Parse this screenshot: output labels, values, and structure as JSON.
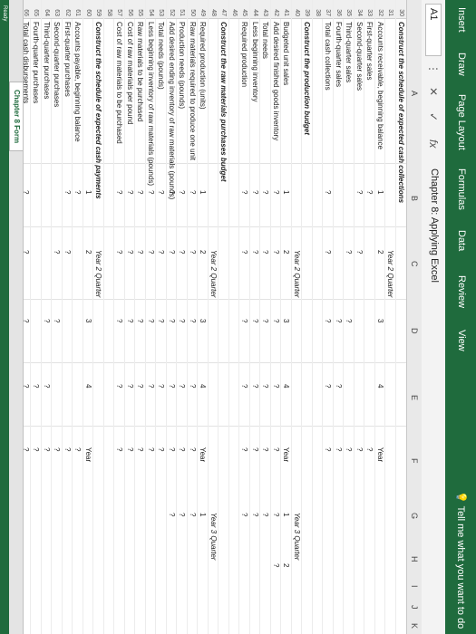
{
  "ribbon": {
    "tabs": [
      "Insert",
      "Draw",
      "Page Layout",
      "Formulas",
      "Data",
      "Review",
      "View"
    ],
    "tell_me": "Tell me what you want to do"
  },
  "formula_bar": {
    "name_box": "A1",
    "content": "Chapter 8: Applying Excel"
  },
  "columns": [
    "A",
    "B",
    "C",
    "D",
    "E",
    "F",
    "G",
    "H",
    "I",
    "J",
    "K"
  ],
  "rows": [
    {
      "n": "30",
      "label": "Construct the schedule of expected cash collections",
      "bold": true,
      "cells": []
    },
    {
      "n": "31",
      "label": "",
      "cells": [
        {
          "c": "c",
          "t": "Year 2 Quarter",
          "i": true
        }
      ]
    },
    {
      "n": "32",
      "label": "Accounts receivable, beginning balance",
      "cells": [
        {
          "c": "b",
          "t": "1"
        },
        {
          "c": "c",
          "t": "2"
        },
        {
          "c": "d",
          "t": "3"
        },
        {
          "c": "e",
          "t": "4"
        },
        {
          "c": "f",
          "t": "Year"
        }
      ]
    },
    {
      "n": "33",
      "label": "First-quarter sales",
      "cells": [
        {
          "c": "b",
          "t": "?"
        },
        {
          "c": "f",
          "t": "?"
        }
      ]
    },
    {
      "n": "34",
      "label": "Second-quarter sales",
      "cells": [
        {
          "c": "b",
          "t": "?"
        },
        {
          "c": "c",
          "t": "?"
        },
        {
          "c": "f",
          "t": "?"
        }
      ]
    },
    {
      "n": "35",
      "label": "Third-quarter sales",
      "cells": [
        {
          "c": "c",
          "t": "?"
        },
        {
          "c": "d",
          "t": "?"
        },
        {
          "c": "f",
          "t": "?"
        }
      ]
    },
    {
      "n": "36",
      "label": "Fourth-quarter sales",
      "cells": [
        {
          "c": "d",
          "t": "?"
        },
        {
          "c": "e",
          "t": "?"
        },
        {
          "c": "f",
          "t": "?"
        }
      ]
    },
    {
      "n": "37",
      "label": "Total cash collections",
      "cells": [
        {
          "c": "b",
          "t": "?"
        },
        {
          "c": "c",
          "t": "?"
        },
        {
          "c": "d",
          "t": "?"
        },
        {
          "c": "e",
          "t": "?"
        },
        {
          "c": "f",
          "t": "?"
        }
      ]
    },
    {
      "n": "38",
      "label": "",
      "cells": []
    },
    {
      "n": "39",
      "label": "Construct the production budget",
      "bold": true,
      "cells": []
    },
    {
      "n": "40",
      "label": "",
      "cells": [
        {
          "c": "c",
          "t": "Year 2 Quarter",
          "i": true
        },
        {
          "c": "g",
          "t": "Year 3 Quarter",
          "i": true
        }
      ]
    },
    {
      "n": "41",
      "label": "Budgeted unit sales",
      "cells": [
        {
          "c": "b",
          "t": "1"
        },
        {
          "c": "c",
          "t": "2"
        },
        {
          "c": "d",
          "t": "3"
        },
        {
          "c": "e",
          "t": "4"
        },
        {
          "c": "f",
          "t": "Year"
        },
        {
          "c": "g",
          "t": "1"
        },
        {
          "c": "h",
          "t": "2"
        }
      ]
    },
    {
      "n": "42",
      "label": "Add desired finished goods inventory",
      "cells": [
        {
          "c": "b",
          "t": "?"
        },
        {
          "c": "c",
          "t": "?"
        },
        {
          "c": "d",
          "t": "?"
        },
        {
          "c": "e",
          "t": "?"
        },
        {
          "c": "f",
          "t": "?"
        },
        {
          "c": "g",
          "t": "?"
        },
        {
          "c": "h",
          "t": "?"
        }
      ]
    },
    {
      "n": "43",
      "label": "Total needs",
      "cells": [
        {
          "c": "b",
          "t": "?"
        },
        {
          "c": "c",
          "t": "?"
        },
        {
          "c": "d",
          "t": "?"
        },
        {
          "c": "e",
          "t": "?"
        },
        {
          "c": "f",
          "t": "?"
        },
        {
          "c": "g",
          "t": "?"
        }
      ]
    },
    {
      "n": "44",
      "label": "Less beginning inventory",
      "cells": [
        {
          "c": "b",
          "t": "?"
        },
        {
          "c": "c",
          "t": "?"
        },
        {
          "c": "d",
          "t": "?"
        },
        {
          "c": "e",
          "t": "?"
        },
        {
          "c": "f",
          "t": "?"
        },
        {
          "c": "g",
          "t": "?"
        }
      ]
    },
    {
      "n": "45",
      "label": "Required production",
      "cells": [
        {
          "c": "b",
          "t": "?"
        },
        {
          "c": "c",
          "t": "?"
        },
        {
          "c": "d",
          "t": "?"
        },
        {
          "c": "e",
          "t": "?"
        },
        {
          "c": "f",
          "t": "?"
        },
        {
          "c": "g",
          "t": "?"
        }
      ]
    },
    {
      "n": "46",
      "label": "",
      "cells": []
    },
    {
      "n": "47",
      "label": "Construct the raw materials purchases budget",
      "bold": true,
      "cells": []
    },
    {
      "n": "48",
      "label": "",
      "cells": [
        {
          "c": "c",
          "t": "Year 2 Quarter",
          "i": true
        },
        {
          "c": "g",
          "t": "Year 3 Quarter",
          "i": true
        }
      ]
    },
    {
      "n": "49",
      "label": "Required production (units)",
      "cells": [
        {
          "c": "b",
          "t": "1"
        },
        {
          "c": "c",
          "t": "2"
        },
        {
          "c": "d",
          "t": "3"
        },
        {
          "c": "e",
          "t": "4"
        },
        {
          "c": "f",
          "t": "Year"
        },
        {
          "c": "g",
          "t": "1"
        }
      ]
    },
    {
      "n": "50",
      "label": "Raw materials required to produce one unit",
      "cells": [
        {
          "c": "b",
          "t": "?"
        },
        {
          "c": "c",
          "t": "?"
        },
        {
          "c": "d",
          "t": "?"
        },
        {
          "c": "e",
          "t": "?"
        },
        {
          "c": "f",
          "t": "?"
        },
        {
          "c": "g",
          "t": "?"
        }
      ]
    },
    {
      "n": "51",
      "label": "Production needs (pounds)",
      "cells": [
        {
          "c": "b",
          "t": "?"
        },
        {
          "c": "c",
          "t": "?"
        },
        {
          "c": "d",
          "t": "?"
        },
        {
          "c": "e",
          "t": "?"
        },
        {
          "c": "f",
          "t": "?"
        },
        {
          "c": "g",
          "t": "?"
        }
      ]
    },
    {
      "n": "52",
      "label": "Add desired ending inventory of raw materials (pounds)",
      "cells": [
        {
          "c": "b",
          "t": "?"
        },
        {
          "c": "c",
          "t": "?"
        },
        {
          "c": "d",
          "t": "?"
        },
        {
          "c": "e",
          "t": "?"
        },
        {
          "c": "f",
          "t": "?"
        },
        {
          "c": "g",
          "t": "?"
        }
      ]
    },
    {
      "n": "53",
      "label": "Total needs (pounds)",
      "cells": [
        {
          "c": "b",
          "t": "?"
        },
        {
          "c": "c",
          "t": "?"
        },
        {
          "c": "d",
          "t": "?"
        },
        {
          "c": "e",
          "t": "?"
        },
        {
          "c": "f",
          "t": "?"
        }
      ]
    },
    {
      "n": "54",
      "label": "Less beginning inventory of raw materials (pounds)",
      "cells": [
        {
          "c": "b",
          "t": "?"
        },
        {
          "c": "c",
          "t": "?"
        },
        {
          "c": "d",
          "t": "?"
        },
        {
          "c": "e",
          "t": "?"
        },
        {
          "c": "f",
          "t": "?"
        }
      ]
    },
    {
      "n": "55",
      "label": "Raw materials to be purchased",
      "cells": [
        {
          "c": "b",
          "t": "?"
        },
        {
          "c": "c",
          "t": "?"
        },
        {
          "c": "d",
          "t": "?"
        },
        {
          "c": "e",
          "t": "?"
        },
        {
          "c": "f",
          "t": "?"
        }
      ]
    },
    {
      "n": "56",
      "label": "Cost of raw materials per pound",
      "cells": [
        {
          "c": "b",
          "t": "?"
        },
        {
          "c": "c",
          "t": "?"
        },
        {
          "c": "d",
          "t": "?"
        },
        {
          "c": "e",
          "t": "?"
        },
        {
          "c": "f",
          "t": "?"
        }
      ]
    },
    {
      "n": "57",
      "label": "Cost of raw materials to be purchased",
      "cells": [
        {
          "c": "b",
          "t": "?"
        },
        {
          "c": "c",
          "t": "?"
        },
        {
          "c": "d",
          "t": "?"
        },
        {
          "c": "e",
          "t": "?"
        },
        {
          "c": "f",
          "t": "?"
        }
      ]
    },
    {
      "n": "58",
      "label": "",
      "cells": []
    },
    {
      "n": "59",
      "label": "Construct the schedule of expected cash payments",
      "bold": true,
      "cells": [
        {
          "c": "c",
          "t": "Year 2 Quarter",
          "i": true
        }
      ]
    },
    {
      "n": "60",
      "label": "",
      "cells": [
        {
          "c": "b",
          "t": "1"
        },
        {
          "c": "c",
          "t": "2"
        },
        {
          "c": "d",
          "t": "3"
        },
        {
          "c": "e",
          "t": "4"
        },
        {
          "c": "f",
          "t": "Year"
        }
      ]
    },
    {
      "n": "61",
      "label": "Accounts payable, beginning balance",
      "cells": [
        {
          "c": "b",
          "t": "?"
        },
        {
          "c": "f",
          "t": "?"
        }
      ]
    },
    {
      "n": "62",
      "label": "First-quarter purchases",
      "cells": [
        {
          "c": "b",
          "t": "?"
        },
        {
          "c": "c",
          "t": "?"
        },
        {
          "c": "f",
          "t": "?"
        }
      ]
    },
    {
      "n": "63",
      "label": "Second-quarter purchases",
      "cells": [
        {
          "c": "c",
          "t": "?"
        },
        {
          "c": "d",
          "t": "?"
        },
        {
          "c": "f",
          "t": "?"
        }
      ]
    },
    {
      "n": "64",
      "label": "Third-quarter purchases",
      "cells": [
        {
          "c": "d",
          "t": "?"
        },
        {
          "c": "e",
          "t": "?"
        },
        {
          "c": "f",
          "t": "?"
        }
      ]
    },
    {
      "n": "65",
      "label": "Fourth-quarter purchases",
      "cells": [
        {
          "c": "e",
          "t": "?"
        },
        {
          "c": "f",
          "t": "?"
        }
      ]
    },
    {
      "n": "66",
      "label": "Total cash disbursements",
      "cells": [
        {
          "c": "b",
          "t": "?"
        },
        {
          "c": "c",
          "t": "?"
        },
        {
          "c": "d",
          "t": "?"
        },
        {
          "c": "e",
          "t": "?"
        },
        {
          "c": "f",
          "t": "?"
        }
      ]
    }
  ],
  "sheet_tab": "Chapter 8 Form",
  "status": "Ready"
}
